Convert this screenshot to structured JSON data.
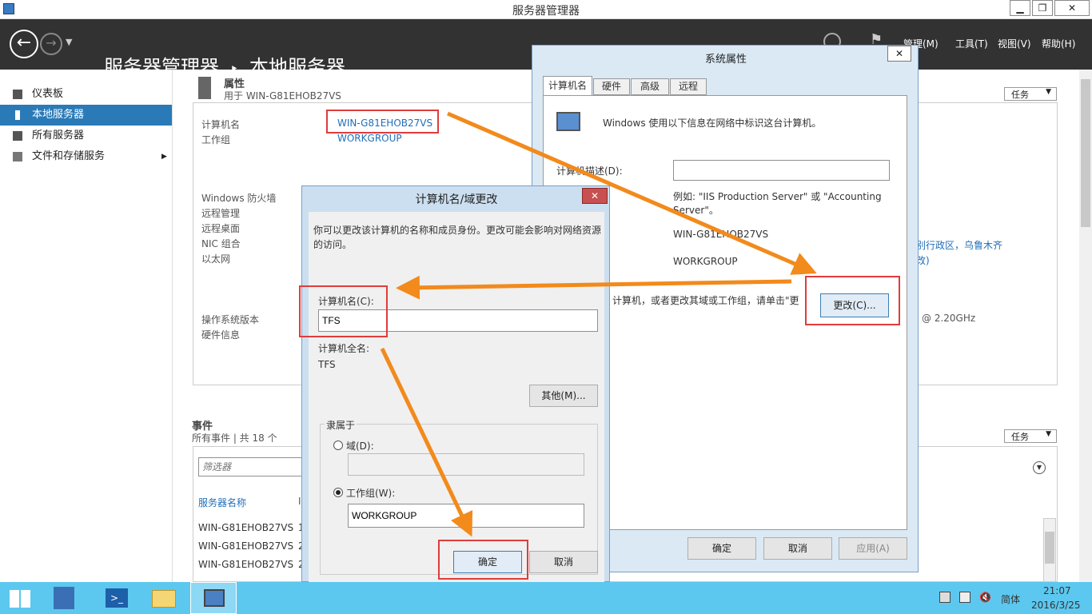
{
  "window": {
    "title": "服务器管理器",
    "min": "▁",
    "max": "❐",
    "close": "✕"
  },
  "header": {
    "breadcrumb_app": "服务器管理器",
    "breadcrumb_sep": "‣",
    "breadcrumb_page": "本地服务器",
    "menus": [
      "管理(M)",
      "工具(T)",
      "视图(V)",
      "帮助(H)"
    ]
  },
  "sidebar": {
    "items": [
      "仪表板",
      "本地服务器",
      "所有服务器",
      "文件和存储服务"
    ]
  },
  "props": {
    "title": "属性",
    "subtitle": "用于 WIN-G81EHOB27VS",
    "tasks": "任务",
    "labels": [
      "计算机名",
      "工作组",
      "Windows 防火墙",
      "远程管理",
      "远程桌面",
      "NIC 组合",
      "以太网",
      "操作系统版本",
      "硬件信息"
    ],
    "computer_name": "WIN-G81EHOB27VS",
    "workgroup": "WORKGROUP",
    "tz1": "别行政区，乌鲁木齐",
    "tz2": "改)",
    "cpu": "@ 2.20GHz"
  },
  "events": {
    "title": "事件",
    "subtitle": "所有事件 | 共 18 个",
    "tasks": "任务",
    "filter_placeholder": "筛选器",
    "col_server": "服务器名称",
    "col_id": "I",
    "rows": [
      {
        "name": "WIN-G81EHOB27VS",
        "id": "1"
      },
      {
        "name": "WIN-G81EHOB27VS",
        "id": "2"
      },
      {
        "name": "WIN-G81EHOB27VS",
        "id": "2"
      }
    ]
  },
  "sysprops": {
    "title": "系统属性",
    "tabs": [
      "计算机名",
      "硬件",
      "高级",
      "远程"
    ],
    "intro": "Windows 使用以下信息在网络中标识这台计算机。",
    "desc_label": "计算机描述(D):",
    "example": "例如: \"IIS Production Server\" 或 \"Accounting Server\"。",
    "full_name": "WIN-G81EHOB27VS",
    "workgroup": "WORKGROUP",
    "rename_text": "计算机，或者更改其域或工作组，请单击\"更",
    "change_btn": "更改(C)...",
    "ok": "确定",
    "cancel": "取消",
    "apply": "应用(A)"
  },
  "rename": {
    "title": "计算机名/域更改",
    "desc": "你可以更改该计算机的名称和成员身份。更改可能会影响对网络资源的访问。",
    "name_label": "计算机名(C):",
    "name_value": "TFS",
    "full_label": "计算机全名:",
    "full_value": "TFS",
    "more_btn": "其他(M)...",
    "member_of": "隶属于",
    "domain_label": "域(D):",
    "workgroup_label": "工作组(W):",
    "workgroup_value": "WORKGROUP",
    "ok": "确定",
    "cancel": "取消"
  },
  "taskbar": {
    "lang": "简体",
    "time": "21:07",
    "date": "2016/3/25"
  },
  "colors": {
    "header": "#323232",
    "accent": "#2a7ab8",
    "taskbar": "#5cc8ef",
    "highlight": "#e03c3c",
    "arrow": "#f28a1c"
  }
}
